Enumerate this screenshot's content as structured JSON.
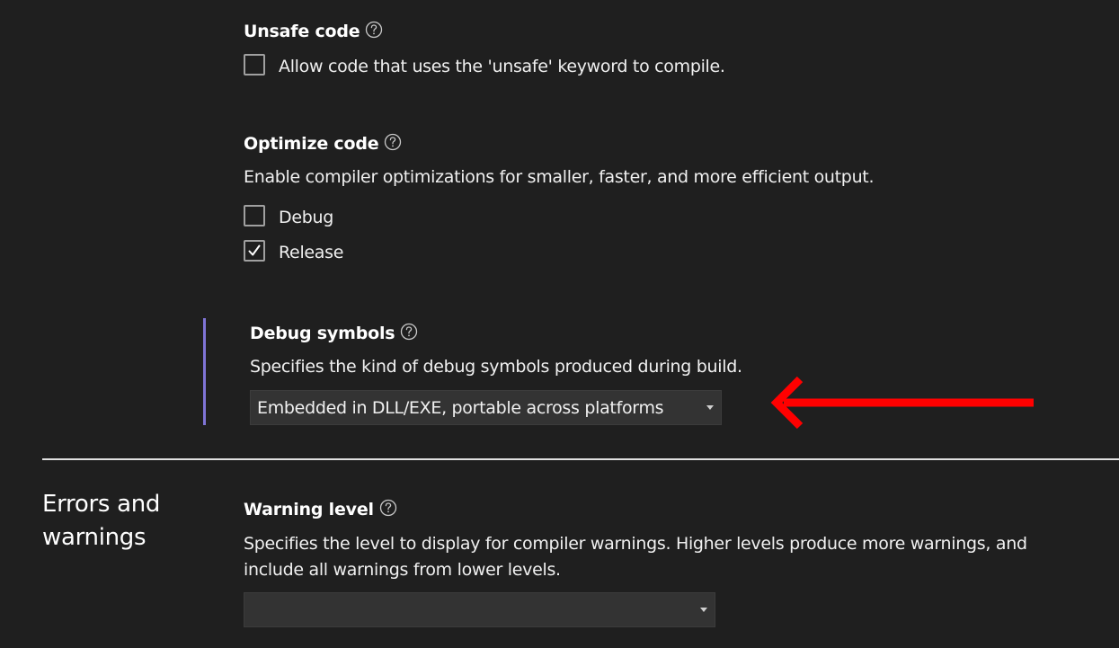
{
  "unsafe_code": {
    "heading": "Unsafe code",
    "checkbox_label": "Allow code that uses the 'unsafe' keyword to compile.",
    "checked": false
  },
  "optimize_code": {
    "heading": "Optimize code",
    "description": "Enable compiler optimizations for smaller, faster, and more efficient output.",
    "options": [
      {
        "label": "Debug",
        "checked": false
      },
      {
        "label": "Release",
        "checked": true
      }
    ]
  },
  "debug_symbols": {
    "heading": "Debug symbols",
    "description": "Specifies the kind of debug symbols produced during build.",
    "selected_value": "Embedded in DLL/EXE, portable across platforms"
  },
  "errors_and_warnings": {
    "section_title_line1": "Errors and",
    "section_title_line2": "warnings",
    "warning_level": {
      "heading": "Warning level",
      "description_line1": "Specifies the level to display for compiler warnings. Higher levels produce more warnings, and",
      "description_line2": "include all warnings from lower levels.",
      "selected_value": ""
    }
  },
  "colors": {
    "background": "#1f1f1f",
    "accent_bar": "#7f74d6",
    "annotation_arrow": "#ff0000"
  }
}
